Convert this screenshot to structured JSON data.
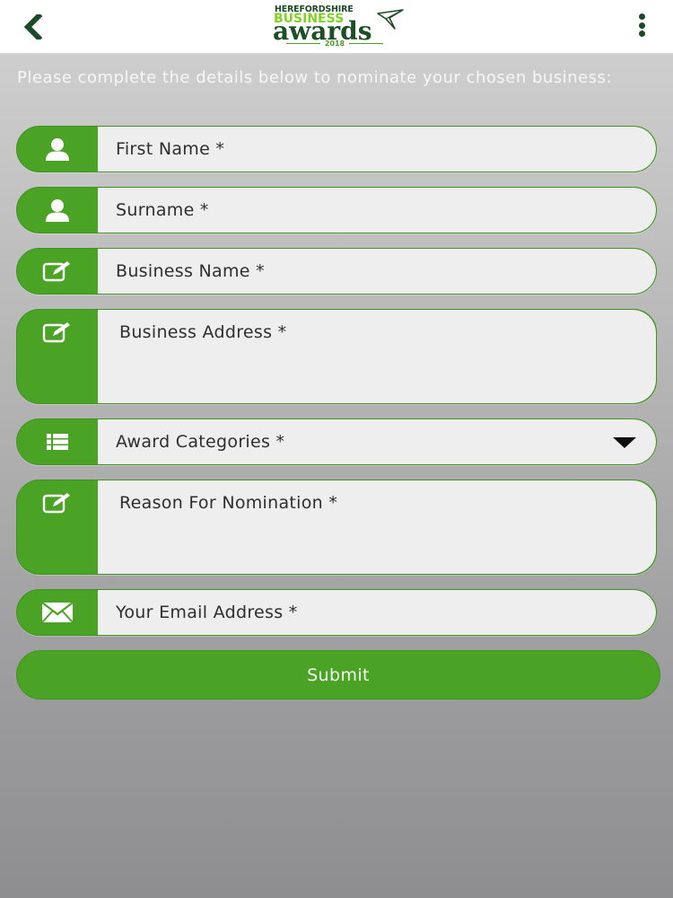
{
  "header": {
    "logo": {
      "line1": "HEREFORDSHIRE",
      "line2": "BUSINESS",
      "line3": "awards",
      "year": "2018"
    },
    "back_icon": "chevron-left-icon",
    "menu_icon": "vertical-ellipsis-icon"
  },
  "intro_text": "Please complete the details below to nominate your chosen business:",
  "form": {
    "first_name": {
      "placeholder": "First Name *",
      "icon": "person-icon"
    },
    "surname": {
      "placeholder": "Surname *",
      "icon": "person-icon"
    },
    "business_name": {
      "placeholder": "Business Name *",
      "icon": "edit-icon"
    },
    "business_address": {
      "placeholder": "Business Address *",
      "icon": "edit-icon"
    },
    "award_categories": {
      "selected": "Award Categories *",
      "icon": "list-icon"
    },
    "reason": {
      "placeholder": "Reason For Nomination *",
      "icon": "edit-icon"
    },
    "email": {
      "placeholder": "Your Email Address *",
      "icon": "envelope-icon"
    },
    "submit_label": "Submit"
  },
  "colors": {
    "accent_green": "#4aa324",
    "field_bg": "#eeeeee",
    "brand_dark_green": "#1b4a27",
    "brand_light_green": "#7dd321"
  }
}
